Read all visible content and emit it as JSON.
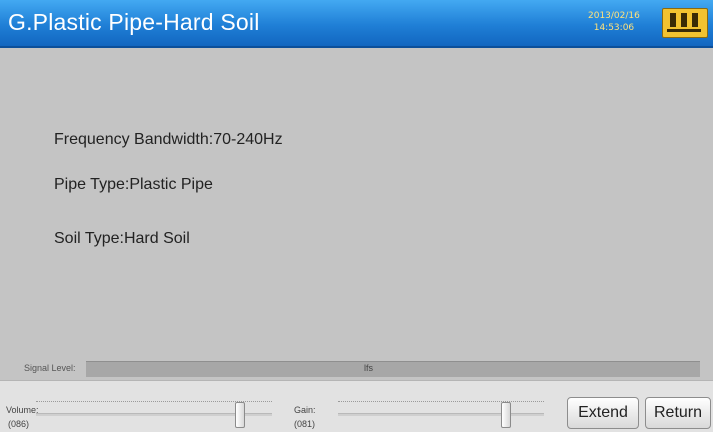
{
  "header": {
    "title": "G.Plastic Pipe-Hard Soil",
    "date": "2013/02/16",
    "time": "14:53:06",
    "battery_icon": "battery-icon"
  },
  "info": {
    "frequency": "Frequency Bandwidth:70-240Hz",
    "pipe_type": "Pipe Type:Plastic Pipe",
    "soil_type": "Soil Type:Hard Soil"
  },
  "signal": {
    "label": "Signal Level:",
    "value_text": "lfs"
  },
  "controls": {
    "volume_label": "Volume:",
    "volume_value": "(086)",
    "volume_level": 0.86,
    "gain_label": "Gain:",
    "gain_value": "(081)",
    "gain_level": 0.81,
    "extend_label": "Extend",
    "return_label": "Return"
  },
  "colors": {
    "titlebar": "#1f7fd6",
    "battery": "#f2c230",
    "background": "#c4c4c4"
  }
}
